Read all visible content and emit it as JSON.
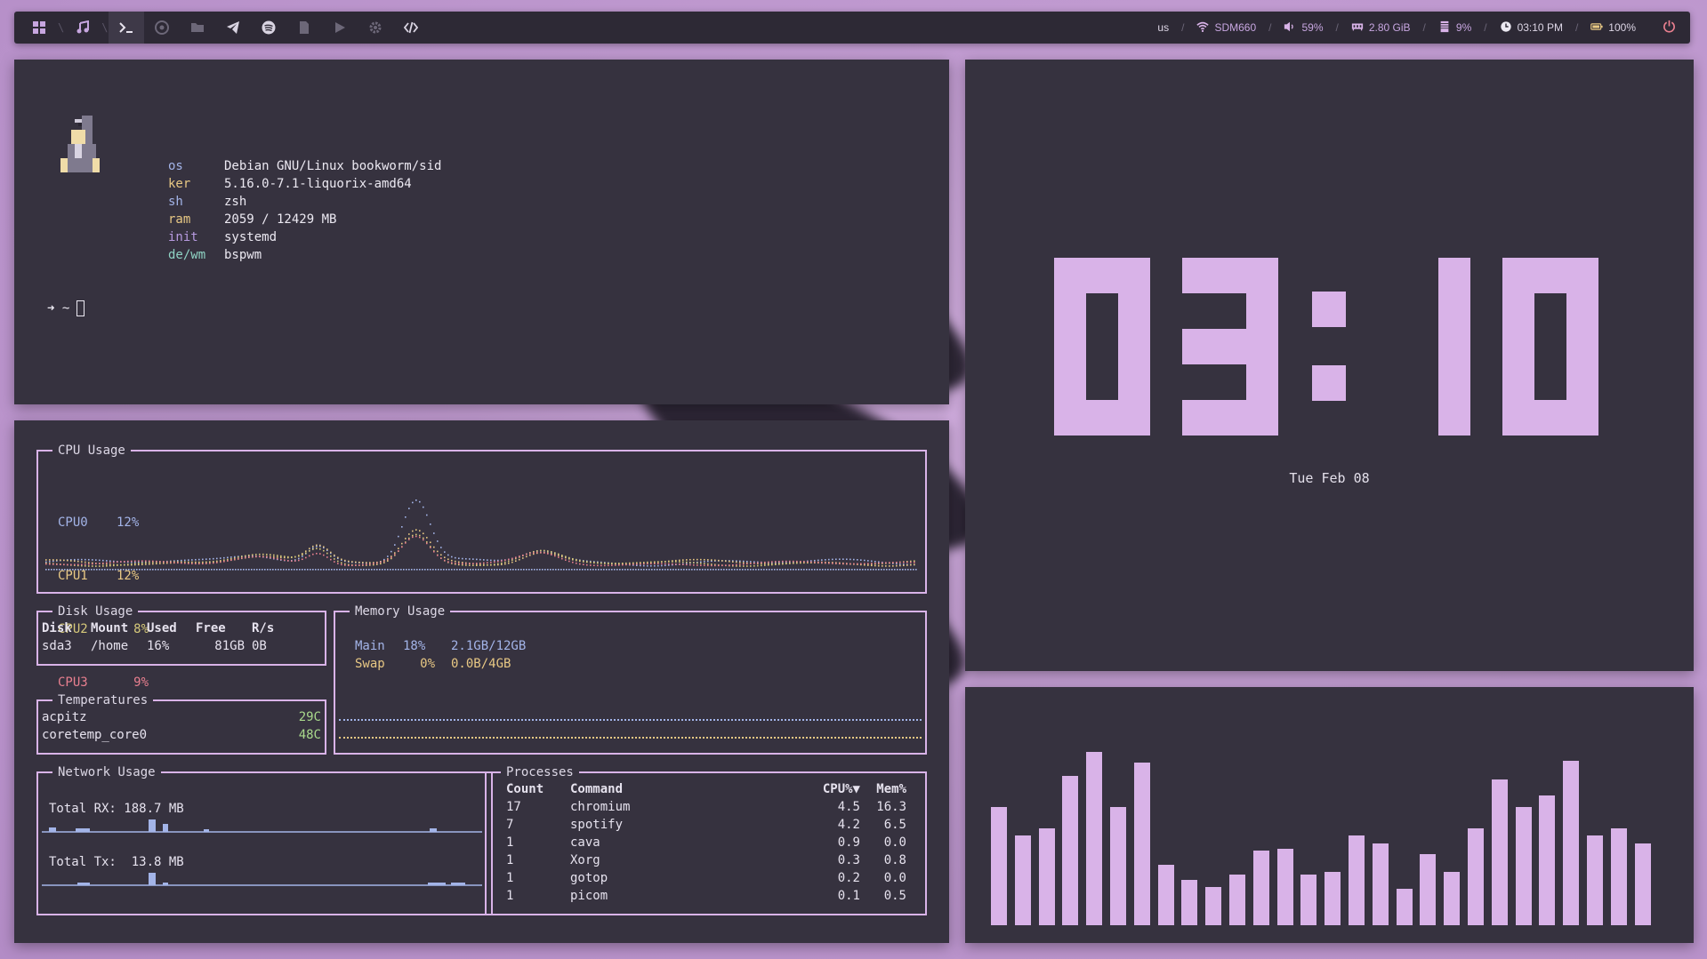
{
  "colors": {
    "accent": "#d9b3e8",
    "bar_bg": "#2d2935",
    "panel_bg": "#36323f",
    "cpu0": "#a3b4e8",
    "cpu1": "#e8c884",
    "cpu2": "#d6c97a",
    "cpu3": "#e87f8f"
  },
  "topbar": {
    "left_icons": [
      "windows-icon",
      "music-note-icon",
      "terminal-icon",
      "chrome-icon",
      "folder-icon",
      "telegram-icon",
      "spotify-icon",
      "document-icon",
      "play-icon",
      "gear-icon",
      "code-icon"
    ],
    "keyboard": "us",
    "wifi": "SDM660",
    "volume": "59%",
    "memory": "2.80 GiB",
    "cpu": "9%",
    "time": "03:10 PM",
    "battery": "100%"
  },
  "fetch": {
    "rows": [
      {
        "key": "os",
        "value": "Debian GNU/Linux bookworm/sid"
      },
      {
        "key": "ker",
        "value": "5.16.0-7.1-liquorix-amd64"
      },
      {
        "key": "sh",
        "value": "zsh"
      },
      {
        "key": "ram",
        "value": "2059 / 12429 MB"
      },
      {
        "key": "init",
        "value": "systemd"
      },
      {
        "key": "de/wm",
        "value": "bspwm"
      }
    ],
    "prompt": "➜  ~"
  },
  "btop": {
    "cpu": {
      "title": "CPU Usage",
      "cores": [
        {
          "name": "CPU0",
          "pct": "12%"
        },
        {
          "name": "CPU1",
          "pct": "12%"
        },
        {
          "name": "CPU2",
          "pct": "8%"
        },
        {
          "name": "CPU3",
          "pct": "9%"
        }
      ]
    },
    "disk": {
      "title": "Disk Usage",
      "headers": [
        "Disk",
        "Mount",
        "Used",
        "Free",
        "R/s"
      ],
      "rows": [
        [
          "sda3",
          "/home",
          "16%",
          "81GB",
          "0B"
        ]
      ]
    },
    "temps": {
      "title": "Temperatures",
      "rows": [
        [
          "acpitz",
          "29C"
        ],
        [
          "coretemp_core0",
          "48C"
        ]
      ]
    },
    "memory": {
      "title": "Memory Usage",
      "rows": [
        [
          "Main",
          "18%",
          "2.1GB/12GB"
        ],
        [
          "Swap",
          "0%",
          "0.0B/4GB"
        ]
      ]
    },
    "network": {
      "title": "Network Usage",
      "rx": "Total RX: 188.7 MB",
      "tx": "Total Tx:  13.8 MB"
    },
    "processes": {
      "title": "Processes",
      "headers": [
        "Count",
        "Command",
        "CPU%▼",
        "Mem%"
      ],
      "rows": [
        [
          "17",
          "chromium",
          "4.5",
          "16.3"
        ],
        [
          "7",
          "spotify",
          "4.2",
          "6.5"
        ],
        [
          "1",
          "cava",
          "0.9",
          "0.0"
        ],
        [
          "1",
          "Xorg",
          "0.3",
          "0.8"
        ],
        [
          "1",
          "gotop",
          "0.2",
          "0.0"
        ],
        [
          "1",
          "picom",
          "0.1",
          "0.5"
        ]
      ]
    }
  },
  "clock": {
    "time": "03:10",
    "date": "Tue Feb 08"
  },
  "cava_levels": [
    0.68,
    0.52,
    0.56,
    0.86,
    1.0,
    0.68,
    0.94,
    0.35,
    0.26,
    0.22,
    0.29,
    0.43,
    0.44,
    0.29,
    0.31,
    0.52,
    0.47,
    0.21,
    0.41,
    0.31,
    0.56,
    0.84,
    0.68,
    0.75,
    0.95,
    0.52,
    0.56,
    0.47
  ]
}
